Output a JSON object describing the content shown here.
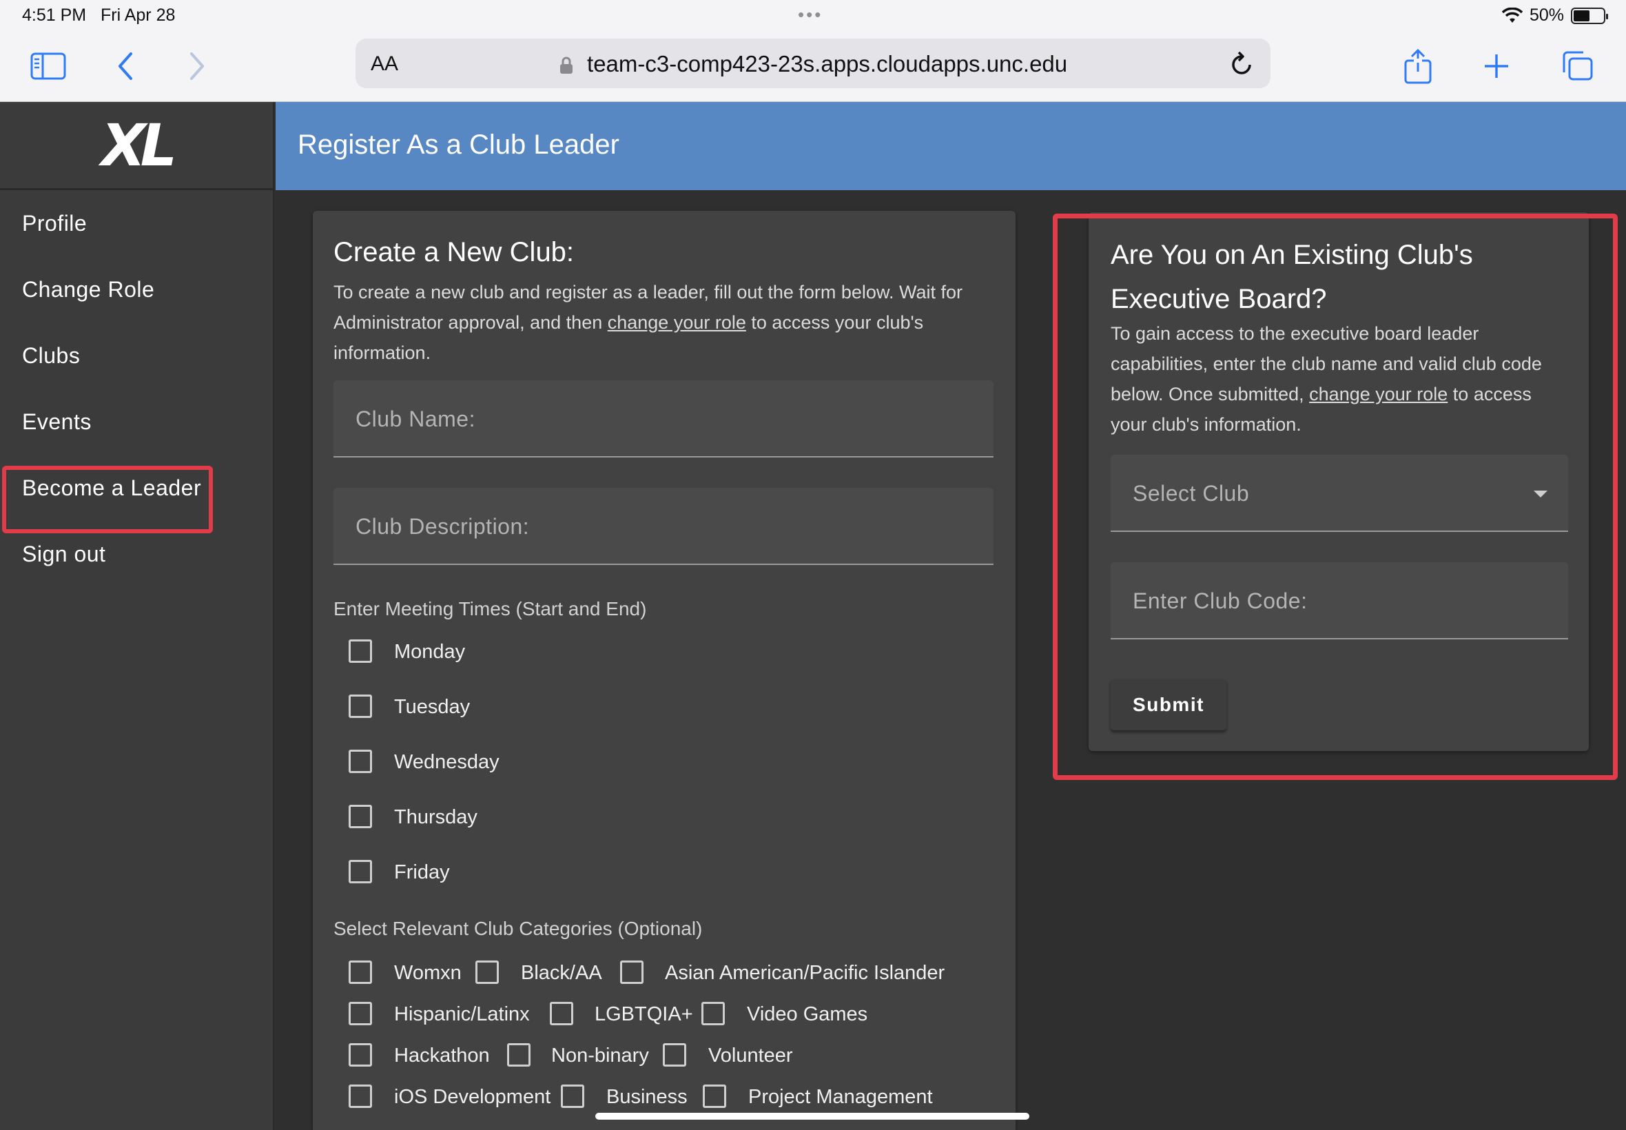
{
  "status_bar": {
    "time": "4:51 PM",
    "date": "Fri Apr 28",
    "battery": "50%"
  },
  "browser": {
    "text_size_label": "AA",
    "url": "team-c3-comp423-23s.apps.cloudapps.unc.edu"
  },
  "app": {
    "logo_text": "XL",
    "page_title": "Register As a Club Leader",
    "accent_color": "#5788c4",
    "highlight_color": "#e23c4a"
  },
  "sidebar": {
    "items": [
      {
        "label": "Profile"
      },
      {
        "label": "Change Role"
      },
      {
        "label": "Clubs"
      },
      {
        "label": "Events"
      },
      {
        "label": "Become a Leader"
      },
      {
        "label": "Sign out"
      }
    ]
  },
  "new_club": {
    "title": "Create a New Club:",
    "desc_before": "To create a new club and register as a leader, fill out the form below. Wait for Administrator approval, and then ",
    "desc_link": "change your role",
    "desc_after": " to access your club's information.",
    "club_name_placeholder": "Club Name:",
    "club_description_placeholder": "Club Description:",
    "meeting_label": "Enter Meeting Times (Start and End)",
    "days": [
      "Monday",
      "Tuesday",
      "Wednesday",
      "Thursday",
      "Friday"
    ],
    "categories_label": "Select Relevant Club Categories (Optional)",
    "categories": [
      "Womxn",
      "Black/AA",
      "Asian American/Pacific Islander",
      "Hispanic/Latinx",
      "LGBTQIA+",
      "Video Games",
      "Hackathon",
      "Non-binary",
      "Volunteer",
      "iOS Development",
      "Business",
      "Project Management"
    ]
  },
  "existing_club": {
    "title_line1": "Are You on An Existing Club's",
    "title_line2": "Executive Board?",
    "desc_before": "To gain access to the executive board leader capabilities, enter the club name and valid club code below. Once submitted, ",
    "desc_link": "change your role",
    "desc_after": " to access your club's information.",
    "select_placeholder": "Select Club",
    "code_placeholder": "Enter Club Code:",
    "submit_label": "Submit"
  }
}
